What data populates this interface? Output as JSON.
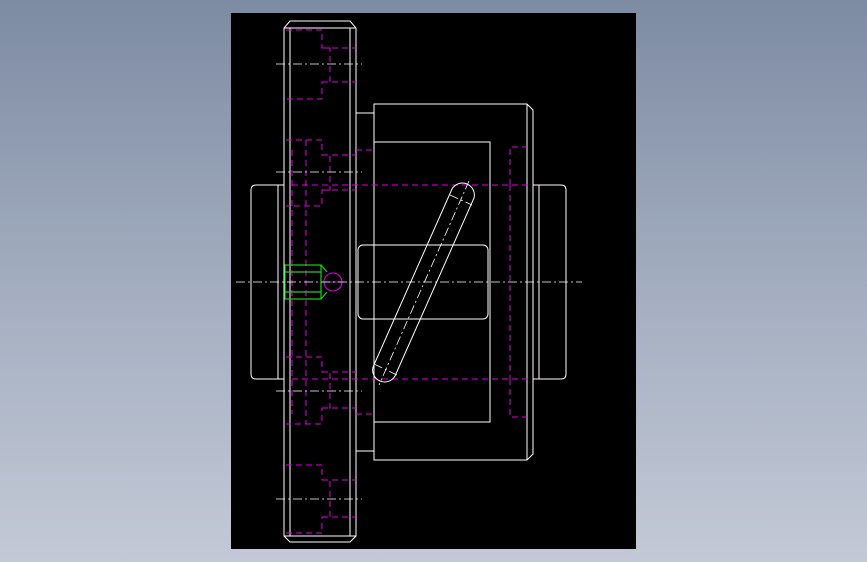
{
  "viewport": {
    "background_gradient": [
      "#7d8ba3",
      "#c3c9d6"
    ],
    "canvas_background": "#000000"
  },
  "drawing": {
    "line_colors": {
      "visible": "#ffffff",
      "hidden": "#e000e0",
      "center": "#ffffff",
      "highlight": "#22cc22"
    },
    "components": [
      "handwheel-rim",
      "hub-body",
      "shaft",
      "slot-link",
      "ball-detent"
    ]
  }
}
